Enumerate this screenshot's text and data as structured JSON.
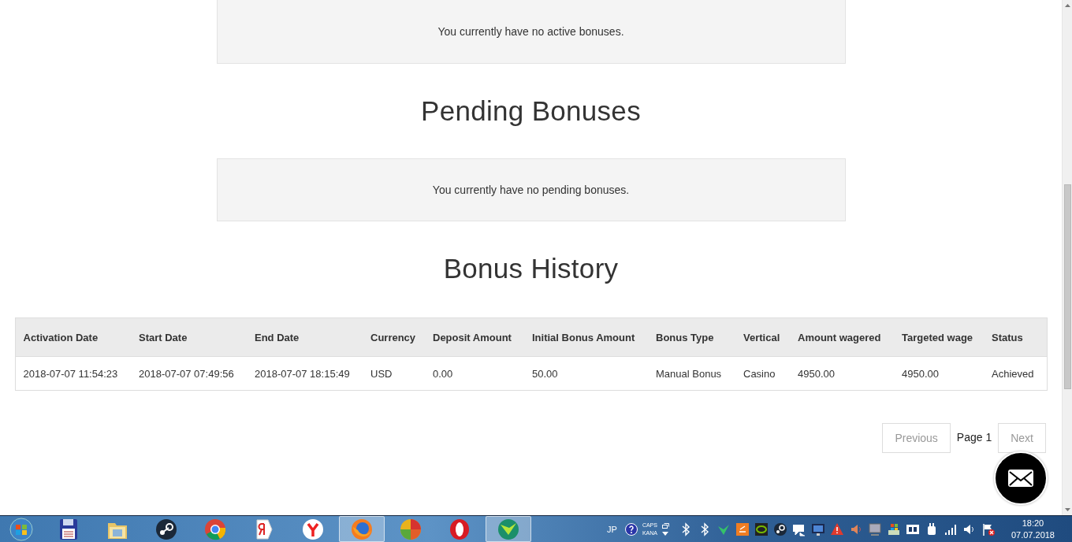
{
  "active_bonuses": {
    "message": "You currently have no active bonuses."
  },
  "pending_bonuses": {
    "title": "Pending Bonuses",
    "message": "You currently have no pending bonuses."
  },
  "bonus_history": {
    "title": "Bonus History",
    "columns": [
      "Activation Date",
      "Start Date",
      "End Date",
      "Currency",
      "Deposit Amount",
      "Initial Bonus Amount",
      "Bonus Type",
      "Vertical",
      "Amount wagered",
      "Targeted wage",
      "Status"
    ],
    "rows": [
      [
        "2018-07-07 11:54:23",
        "2018-07-07 07:49:56",
        "2018-07-07 18:15:49",
        "USD",
        "0.00",
        "50.00",
        "Manual Bonus",
        "Casino",
        "4950.00",
        "4950.00",
        "Achieved"
      ]
    ]
  },
  "pagination": {
    "previous": {
      "label": "Previous",
      "disabled": true
    },
    "page": "Page 1",
    "next": {
      "label": "Next",
      "disabled": true
    }
  },
  "taskbar": {
    "apps": [
      {
        "kind": "start",
        "active": false
      },
      {
        "kind": "floppy",
        "active": false
      },
      {
        "kind": "folder",
        "active": false
      },
      {
        "kind": "steam",
        "active": false
      },
      {
        "kind": "chrome",
        "active": false
      },
      {
        "kind": "yandex",
        "active": false
      },
      {
        "kind": "ybrowser",
        "active": false
      },
      {
        "kind": "firefox",
        "active": true
      },
      {
        "kind": "colorful",
        "active": false
      },
      {
        "kind": "opera",
        "active": false
      },
      {
        "kind": "green",
        "active": true
      }
    ],
    "language": "JP",
    "caps": "CAPS",
    "kana": "KANA",
    "tray": [
      {
        "kind": "bluetooth"
      },
      {
        "kind": "bluetooth"
      },
      {
        "kind": "arrow"
      },
      {
        "kind": "orange"
      },
      {
        "kind": "nvidia"
      },
      {
        "kind": "steam"
      },
      {
        "kind": "chat"
      },
      {
        "kind": "monitor"
      },
      {
        "kind": "warning"
      },
      {
        "kind": "speaker"
      },
      {
        "kind": "display"
      },
      {
        "kind": "flag"
      },
      {
        "kind": "panel"
      },
      {
        "kind": "plug"
      },
      {
        "kind": "signal"
      },
      {
        "kind": "volume"
      },
      {
        "kind": "flagx"
      }
    ],
    "time": "18:20",
    "date": "07.07.2018"
  }
}
